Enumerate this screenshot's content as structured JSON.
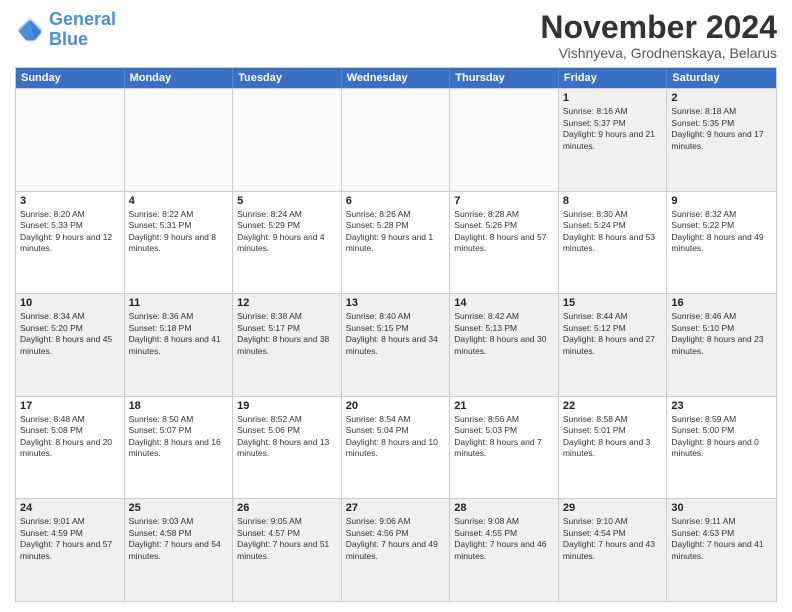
{
  "header": {
    "logo_general": "General",
    "logo_blue": "Blue",
    "month_title": "November 2024",
    "subtitle": "Vishnyeva, Grodnenskaya, Belarus"
  },
  "weekdays": [
    "Sunday",
    "Monday",
    "Tuesday",
    "Wednesday",
    "Thursday",
    "Friday",
    "Saturday"
  ],
  "rows": [
    [
      {
        "day": "",
        "info": ""
      },
      {
        "day": "",
        "info": ""
      },
      {
        "day": "",
        "info": ""
      },
      {
        "day": "",
        "info": ""
      },
      {
        "day": "",
        "info": ""
      },
      {
        "day": "1",
        "info": "Sunrise: 8:16 AM\nSunset: 5:37 PM\nDaylight: 9 hours and 21 minutes."
      },
      {
        "day": "2",
        "info": "Sunrise: 8:18 AM\nSunset: 5:35 PM\nDaylight: 9 hours and 17 minutes."
      }
    ],
    [
      {
        "day": "3",
        "info": "Sunrise: 8:20 AM\nSunset: 5:33 PM\nDaylight: 9 hours and 12 minutes."
      },
      {
        "day": "4",
        "info": "Sunrise: 8:22 AM\nSunset: 5:31 PM\nDaylight: 9 hours and 8 minutes."
      },
      {
        "day": "5",
        "info": "Sunrise: 8:24 AM\nSunset: 5:29 PM\nDaylight: 9 hours and 4 minutes."
      },
      {
        "day": "6",
        "info": "Sunrise: 8:26 AM\nSunset: 5:28 PM\nDaylight: 9 hours and 1 minute."
      },
      {
        "day": "7",
        "info": "Sunrise: 8:28 AM\nSunset: 5:26 PM\nDaylight: 8 hours and 57 minutes."
      },
      {
        "day": "8",
        "info": "Sunrise: 8:30 AM\nSunset: 5:24 PM\nDaylight: 8 hours and 53 minutes."
      },
      {
        "day": "9",
        "info": "Sunrise: 8:32 AM\nSunset: 5:22 PM\nDaylight: 8 hours and 49 minutes."
      }
    ],
    [
      {
        "day": "10",
        "info": "Sunrise: 8:34 AM\nSunset: 5:20 PM\nDaylight: 8 hours and 45 minutes."
      },
      {
        "day": "11",
        "info": "Sunrise: 8:36 AM\nSunset: 5:18 PM\nDaylight: 8 hours and 41 minutes."
      },
      {
        "day": "12",
        "info": "Sunrise: 8:38 AM\nSunset: 5:17 PM\nDaylight: 8 hours and 38 minutes."
      },
      {
        "day": "13",
        "info": "Sunrise: 8:40 AM\nSunset: 5:15 PM\nDaylight: 8 hours and 34 minutes."
      },
      {
        "day": "14",
        "info": "Sunrise: 8:42 AM\nSunset: 5:13 PM\nDaylight: 8 hours and 30 minutes."
      },
      {
        "day": "15",
        "info": "Sunrise: 8:44 AM\nSunset: 5:12 PM\nDaylight: 8 hours and 27 minutes."
      },
      {
        "day": "16",
        "info": "Sunrise: 8:46 AM\nSunset: 5:10 PM\nDaylight: 8 hours and 23 minutes."
      }
    ],
    [
      {
        "day": "17",
        "info": "Sunrise: 8:48 AM\nSunset: 5:08 PM\nDaylight: 8 hours and 20 minutes."
      },
      {
        "day": "18",
        "info": "Sunrise: 8:50 AM\nSunset: 5:07 PM\nDaylight: 8 hours and 16 minutes."
      },
      {
        "day": "19",
        "info": "Sunrise: 8:52 AM\nSunset: 5:06 PM\nDaylight: 8 hours and 13 minutes."
      },
      {
        "day": "20",
        "info": "Sunrise: 8:54 AM\nSunset: 5:04 PM\nDaylight: 8 hours and 10 minutes."
      },
      {
        "day": "21",
        "info": "Sunrise: 8:56 AM\nSunset: 5:03 PM\nDaylight: 8 hours and 7 minutes."
      },
      {
        "day": "22",
        "info": "Sunrise: 8:58 AM\nSunset: 5:01 PM\nDaylight: 8 hours and 3 minutes."
      },
      {
        "day": "23",
        "info": "Sunrise: 8:59 AM\nSunset: 5:00 PM\nDaylight: 8 hours and 0 minutes."
      }
    ],
    [
      {
        "day": "24",
        "info": "Sunrise: 9:01 AM\nSunset: 4:59 PM\nDaylight: 7 hours and 57 minutes."
      },
      {
        "day": "25",
        "info": "Sunrise: 9:03 AM\nSunset: 4:58 PM\nDaylight: 7 hours and 54 minutes."
      },
      {
        "day": "26",
        "info": "Sunrise: 9:05 AM\nSunset: 4:57 PM\nDaylight: 7 hours and 51 minutes."
      },
      {
        "day": "27",
        "info": "Sunrise: 9:06 AM\nSunset: 4:56 PM\nDaylight: 7 hours and 49 minutes."
      },
      {
        "day": "28",
        "info": "Sunrise: 9:08 AM\nSunset: 4:55 PM\nDaylight: 7 hours and 46 minutes."
      },
      {
        "day": "29",
        "info": "Sunrise: 9:10 AM\nSunset: 4:54 PM\nDaylight: 7 hours and 43 minutes."
      },
      {
        "day": "30",
        "info": "Sunrise: 9:11 AM\nSunset: 4:53 PM\nDaylight: 7 hours and 41 minutes."
      }
    ]
  ]
}
